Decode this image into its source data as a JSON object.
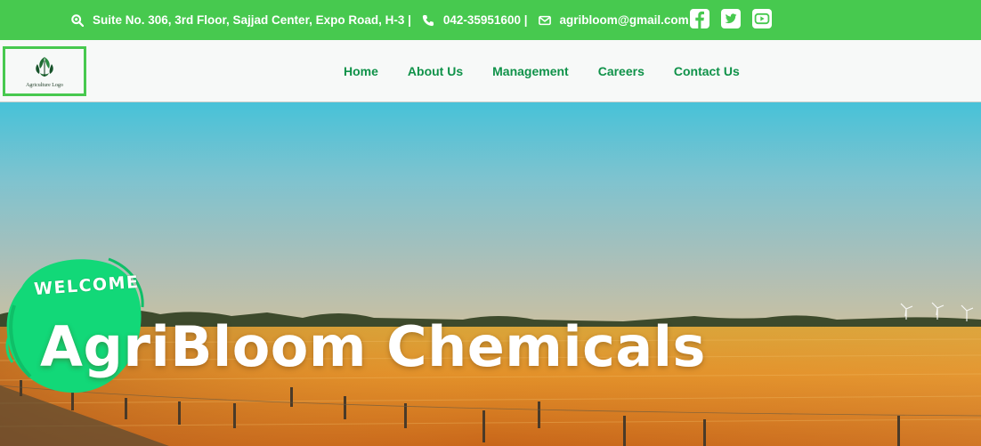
{
  "topbar": {
    "address": "Suite No. 306, 3rd Floor, Sajjad Center, Expo Road, H-3 |",
    "phone": "042-35951600 |",
    "email": "agribloom@gmail.com",
    "social": [
      "facebook-icon",
      "twitter-icon",
      "youtube-icon"
    ],
    "bg_color": "#47c94f"
  },
  "logo": {
    "text": "Agriculture Logo"
  },
  "nav": {
    "items": [
      "Home",
      "About Us",
      "Management",
      "Careers",
      "Contact Us"
    ],
    "color": "#0f9249"
  },
  "hero": {
    "welcome": "WELCOME",
    "title": "AgriBloom Chemicals",
    "blob_color": "#12d878"
  }
}
